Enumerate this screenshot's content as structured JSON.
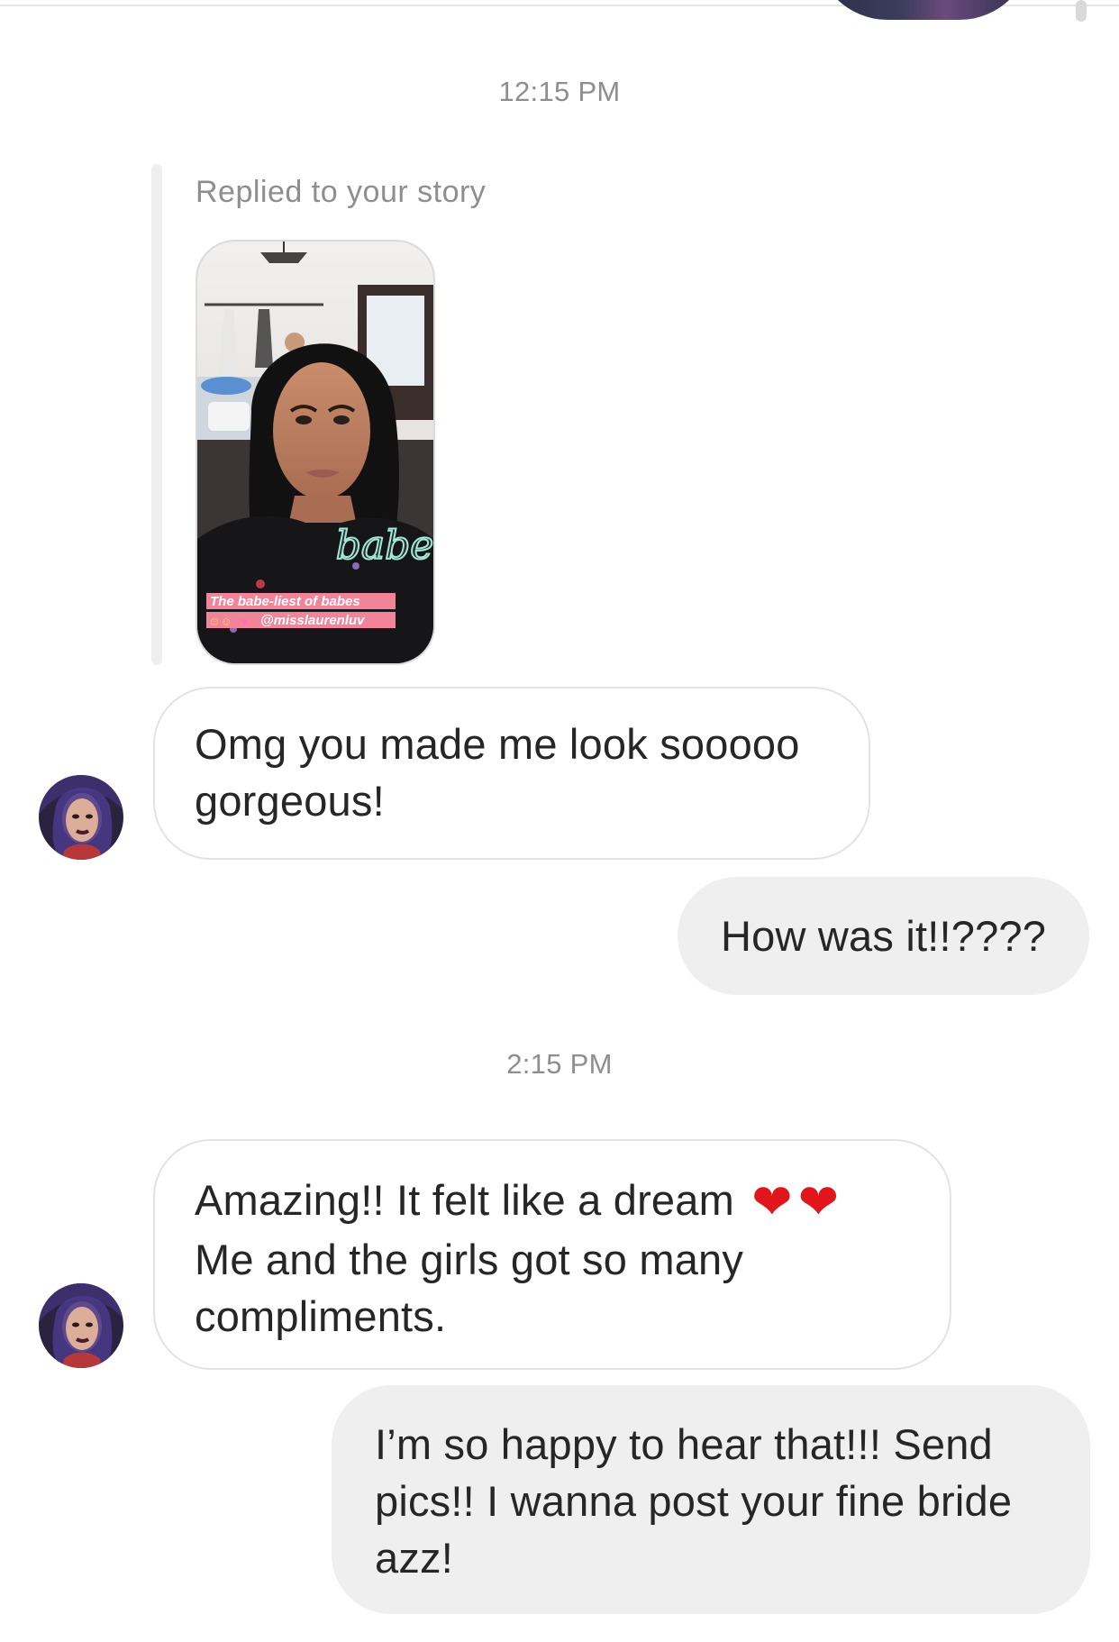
{
  "conversation": {
    "timestamps": [
      "12:15 PM",
      "2:15 PM"
    ],
    "story_reply": {
      "label": "Replied to your story",
      "story_caption_line1": "The babe-liest of babes",
      "story_caption_line2": "@misslaurenluv",
      "story_sticker": "babe"
    },
    "messages": [
      {
        "sender": "them",
        "lines": [
          "Omg you made me look sooooo",
          "gorgeous!"
        ]
      },
      {
        "sender": "me",
        "lines": [
          "How was it!!????"
        ]
      },
      {
        "sender": "them",
        "lines": [
          "Amazing!! It felt like a dream",
          "Me and the girls got so many",
          "compliments."
        ],
        "emoji": [
          "❤",
          "❤"
        ]
      },
      {
        "sender": "me",
        "lines": [
          "I’m so happy to hear that!!! Send",
          "pics!! I wanna post your fine bride",
          "azz!"
        ]
      }
    ]
  },
  "colors": {
    "incoming_bubble_border": "#e3e3e3",
    "outgoing_bubble_bg": "#efefef",
    "timestamp_text": "#8e8e8e",
    "heart": "#e0161c"
  }
}
